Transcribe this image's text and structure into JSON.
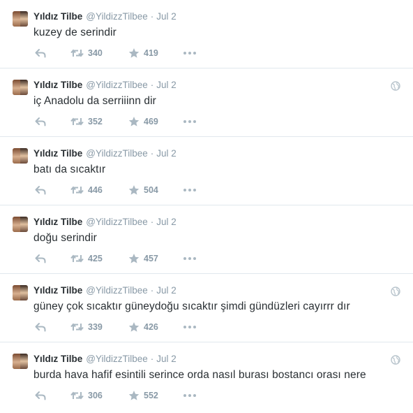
{
  "tweets": [
    {
      "name": "Yıldız Tilbe",
      "handle": "@YildizzTilbee",
      "separator": "·",
      "time": "Jul 2",
      "text": "kuzey de serindir",
      "retweets": "340",
      "favorites": "419",
      "has_globe": false
    },
    {
      "name": "Yıldız Tilbe",
      "handle": "@YildizzTilbee",
      "separator": "·",
      "time": "Jul 2",
      "text": "iç Anadolu da serriiinn dir",
      "retweets": "352",
      "favorites": "469",
      "has_globe": true
    },
    {
      "name": "Yıldız Tilbe",
      "handle": "@YildizzTilbee",
      "separator": "·",
      "time": "Jul 2",
      "text": "batı da sıcaktır",
      "retweets": "446",
      "favorites": "504",
      "has_globe": false
    },
    {
      "name": "Yıldız Tilbe",
      "handle": "@YildizzTilbee",
      "separator": "·",
      "time": "Jul 2",
      "text": "doğu serindir",
      "retweets": "425",
      "favorites": "457",
      "has_globe": false
    },
    {
      "name": "Yıldız Tilbe",
      "handle": "@YildizzTilbee",
      "separator": "·",
      "time": "Jul 2",
      "text": "güney  çok sıcaktır güneydoğu sıcaktır şimdi gündüzleri cayırrr dır",
      "retweets": "339",
      "favorites": "426",
      "has_globe": true
    },
    {
      "name": "Yıldız Tilbe",
      "handle": "@YildizzTilbee",
      "separator": "·",
      "time": "Jul 2",
      "text": "burda hava hafif esintili serince orda nasıl  burası bostancı orası nere",
      "retweets": "306",
      "favorites": "552",
      "has_globe": true
    }
  ],
  "icons": {
    "avatar": "avatar",
    "reply": "reply-icon",
    "retweet": "retweet-icon",
    "favorite": "star-icon",
    "more": "more-icon",
    "globe": "globe-icon"
  },
  "colors": {
    "name": "#292f33",
    "meta": "#8899a6",
    "action_icon": "#aab8c2",
    "divider": "#e1e8ed"
  }
}
